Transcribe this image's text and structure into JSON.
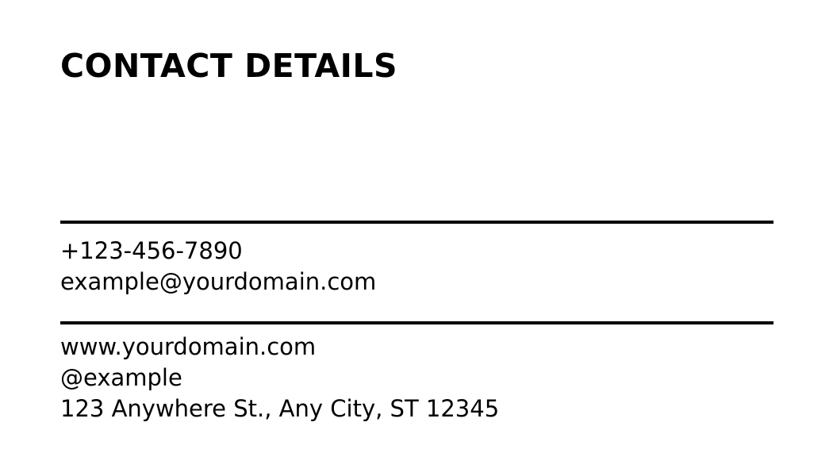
{
  "card": {
    "title": "CONTACT DETAILS",
    "contact": {
      "phone": "+123-456-7890",
      "email": "example@yourdomain.com"
    },
    "online": {
      "website": "www.yourdomain.com",
      "social": "@example",
      "address": "123 Anywhere St., Any City, ST 12345"
    }
  },
  "colors": {
    "background": "#ffffff",
    "text": "#000000",
    "rule": "#000000"
  }
}
